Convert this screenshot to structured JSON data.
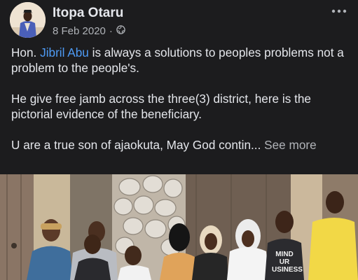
{
  "post": {
    "author": "Itopa Otaru",
    "date": "8 Feb 2020",
    "separator": "·",
    "privacy_icon": "globe-icon",
    "more_icon": "more-options-icon",
    "paragraph1": {
      "prefix": "Hon. ",
      "mention": "Jibril Abu",
      "suffix": " is always a solutions to peoples problems not a problem to the people's."
    },
    "paragraph2": "He give free jamb across the three(3) district, here is the pictorial evidence of the beneficiary.",
    "paragraph3": "U are a true son of ajaokuta, May God contin...",
    "see_more": "See more"
  },
  "photo": {
    "shirt_text": [
      "MIND",
      "UR",
      "USINESS"
    ]
  },
  "colors": {
    "background": "#1c1c1e",
    "text": "#e4e6eb",
    "secondary_text": "#b0b3b8",
    "link": "#4e9bf5"
  }
}
